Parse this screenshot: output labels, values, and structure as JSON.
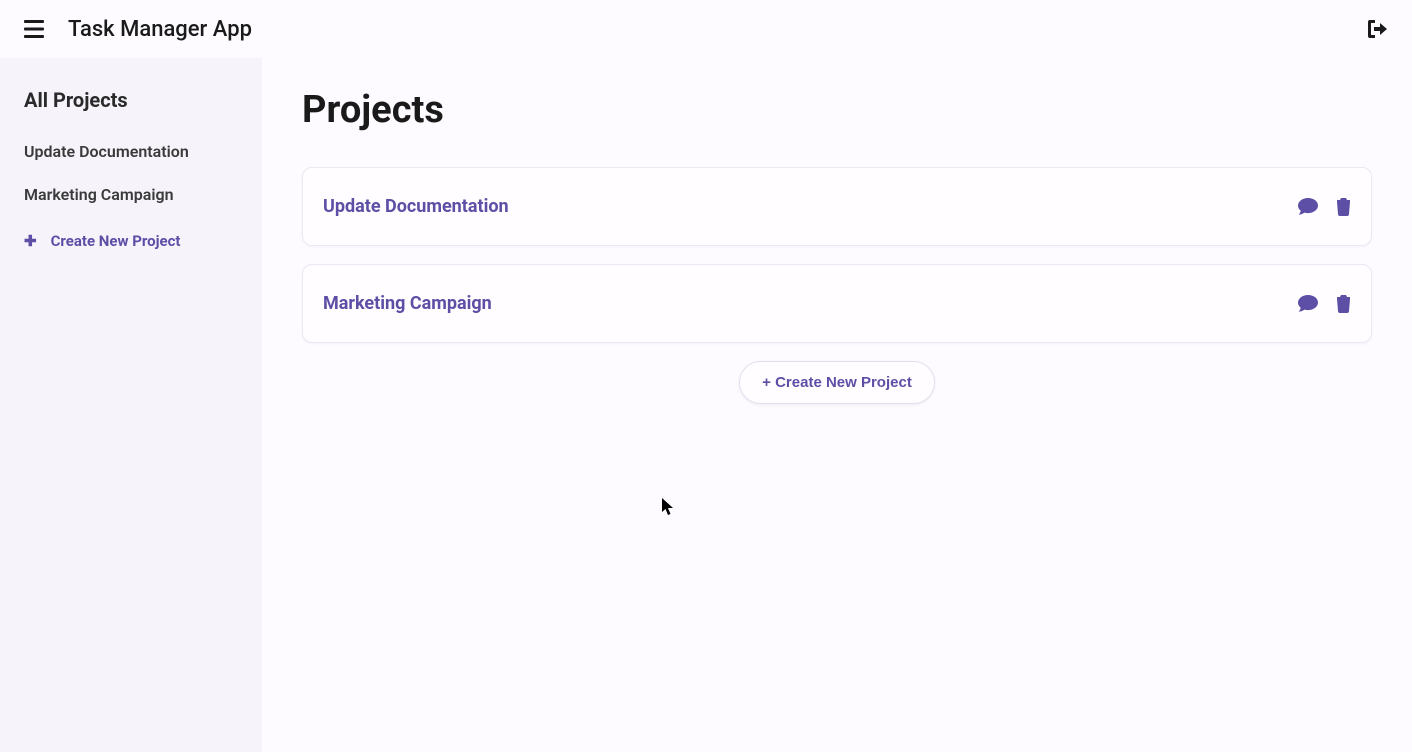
{
  "topbar": {
    "title": "Task Manager App"
  },
  "sidebar": {
    "title": "All Projects",
    "items": [
      {
        "label": "Update Documentation"
      },
      {
        "label": "Marketing Campaign"
      }
    ],
    "create_label": "Create New Project"
  },
  "main": {
    "title": "Projects",
    "projects": [
      {
        "name": "Update Documentation"
      },
      {
        "name": "Marketing Campaign"
      }
    ],
    "create_button": "+ Create New Project"
  }
}
